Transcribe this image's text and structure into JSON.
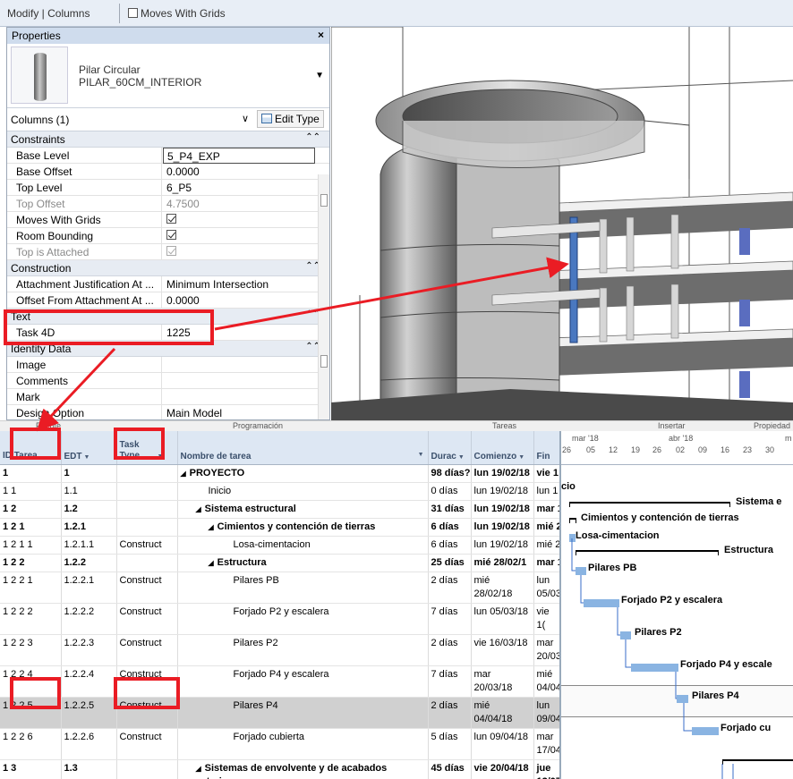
{
  "topbar": {
    "breadcrumb": "Modify | Columns",
    "moves_with_grids": "Moves With Grids"
  },
  "properties": {
    "title": "Properties",
    "close": "×",
    "type_family": "Pilar Circular",
    "type_name": "PILAR_60CM_INTERIOR",
    "instance_selector": "Columns (1)",
    "edit_type": "Edit Type",
    "groups": {
      "constraints": "Constraints",
      "construction": "Construction",
      "text": "Text",
      "identity": "Identity Data"
    },
    "constraints": [
      {
        "k": "Base Level",
        "v": "5_P4_EXP"
      },
      {
        "k": "Base Offset",
        "v": "0.0000"
      },
      {
        "k": "Top Level",
        "v": "6_P5"
      },
      {
        "k": "Top Offset",
        "v": "4.7500"
      },
      {
        "k": "Moves With Grids",
        "v": ""
      },
      {
        "k": "Room Bounding",
        "v": ""
      },
      {
        "k": "Top is Attached",
        "v": ""
      }
    ],
    "construction": [
      {
        "k": "Attachment Justification At ...",
        "v": "Minimum Intersection"
      },
      {
        "k": "Offset From Attachment At ...",
        "v": "0.0000"
      }
    ],
    "text": [
      {
        "k": "Task 4D",
        "v": "1225"
      }
    ],
    "identity": [
      {
        "k": "Image",
        "v": ""
      },
      {
        "k": "Comments",
        "v": ""
      },
      {
        "k": "Mark",
        "v": ""
      },
      {
        "k": "Design Option",
        "v": "Main Model"
      }
    ]
  },
  "project": {
    "ribbon": {
      "fuente": "Fuente",
      "programacion": "Programación",
      "tareas": "Tareas",
      "insertar": "Insertar",
      "propiedades": "Propiedad"
    },
    "headers": {
      "id": "ID Tarea",
      "edt": "EDT",
      "type": "Task Type",
      "name": "Nombre de tarea",
      "dur": "Durac",
      "start": "Comienzo",
      "end": "Fin"
    },
    "rows": [
      {
        "id": "1",
        "edt": "1",
        "type": "",
        "name": "PROYECTO",
        "dur": "98 días?",
        "start": "lun 19/02/18",
        "end": "vie 1"
      },
      {
        "id": "1 1",
        "edt": "1.1",
        "type": "",
        "name": "Inicio",
        "dur": "0 días",
        "start": "lun 19/02/18",
        "end": "lun 1"
      },
      {
        "id": "1 2",
        "edt": "1.2",
        "type": "",
        "name": "Sistema estructural",
        "dur": "31 días",
        "start": "lun 19/02/18",
        "end": "mar 1"
      },
      {
        "id": "1 2 1",
        "edt": "1.2.1",
        "type": "",
        "name": "Cimientos y contención de tierras",
        "dur": "6 días",
        "start": "lun 19/02/18",
        "end": "mié 2"
      },
      {
        "id": "1 2 1 1",
        "edt": "1.2.1.1",
        "type": "Construct",
        "name": "Losa-cimentacion",
        "dur": "6 días",
        "start": "lun 19/02/18",
        "end": "mié 2"
      },
      {
        "id": "1 2 2",
        "edt": "1.2.2",
        "type": "",
        "name": "Estructura",
        "dur": "25 días",
        "start": "mié 28/02/1",
        "end": "mar 1"
      },
      {
        "id": "1 2 2 1",
        "edt": "1.2.2.1",
        "type": "Construct",
        "name": "Pilares PB",
        "dur": "2 días",
        "start": "mié 28/02/18",
        "end": "lun 05/03"
      },
      {
        "id": "1 2 2 2",
        "edt": "1.2.2.2",
        "type": "Construct",
        "name": "Forjado P2 y escalera",
        "dur": "7 días",
        "start": "lun 05/03/18",
        "end": "vie 1("
      },
      {
        "id": "1 2 2 3",
        "edt": "1.2.2.3",
        "type": "Construct",
        "name": "Pilares P2",
        "dur": "2 días",
        "start": "vie 16/03/18",
        "end": "mar 20/03"
      },
      {
        "id": "1 2 2 4",
        "edt": "1.2.2.4",
        "type": "Construct",
        "name": "Forjado P4 y escalera",
        "dur": "7 días",
        "start": "mar 20/03/18",
        "end": "mié 04/04"
      },
      {
        "id": "1 2 2 5",
        "edt": "1.2.2.5",
        "type": "Construct",
        "name": "Pilares P4",
        "dur": "2 días",
        "start": "mié 04/04/18",
        "end": "lun 09/04"
      },
      {
        "id": "1 2 2 6",
        "edt": "1.2.2.6",
        "type": "Construct",
        "name": "Forjado cubierta",
        "dur": "5 días",
        "start": "lun 09/04/18",
        "end": "mar 17/04"
      },
      {
        "id": "1 3",
        "edt": "1.3",
        "type": "",
        "name": "Sistemas de envolvente y de acabados exteriores",
        "dur": "45 días",
        "start": "vie 20/04/18",
        "end": "jue 12/07"
      }
    ],
    "timescale": {
      "months": [
        "mar '18",
        "abr '18",
        "m"
      ],
      "days": [
        "26",
        "05",
        "12",
        "19",
        "26",
        "02",
        "09",
        "16",
        "23",
        "30"
      ]
    },
    "bar_labels": {
      "inicio": "cio",
      "sistema": "Sistema e",
      "cimientos": "Cimientos y contención de tierras",
      "losa": "Losa-cimentacion",
      "estructura": "Estructura",
      "pilares_pb": "Pilares PB",
      "forjado_p2": "Forjado P2 y escalera",
      "pilares_p2": "Pilares P2",
      "forjado_p4": "Forjado P4 y escale",
      "pilares_p4": "Pilares P4",
      "forjado_cub": "Forjado cu"
    }
  },
  "colors": {
    "annotation": "#ea1c24",
    "bar": "#8ab4e2",
    "selected_element": "#4a78c0"
  }
}
